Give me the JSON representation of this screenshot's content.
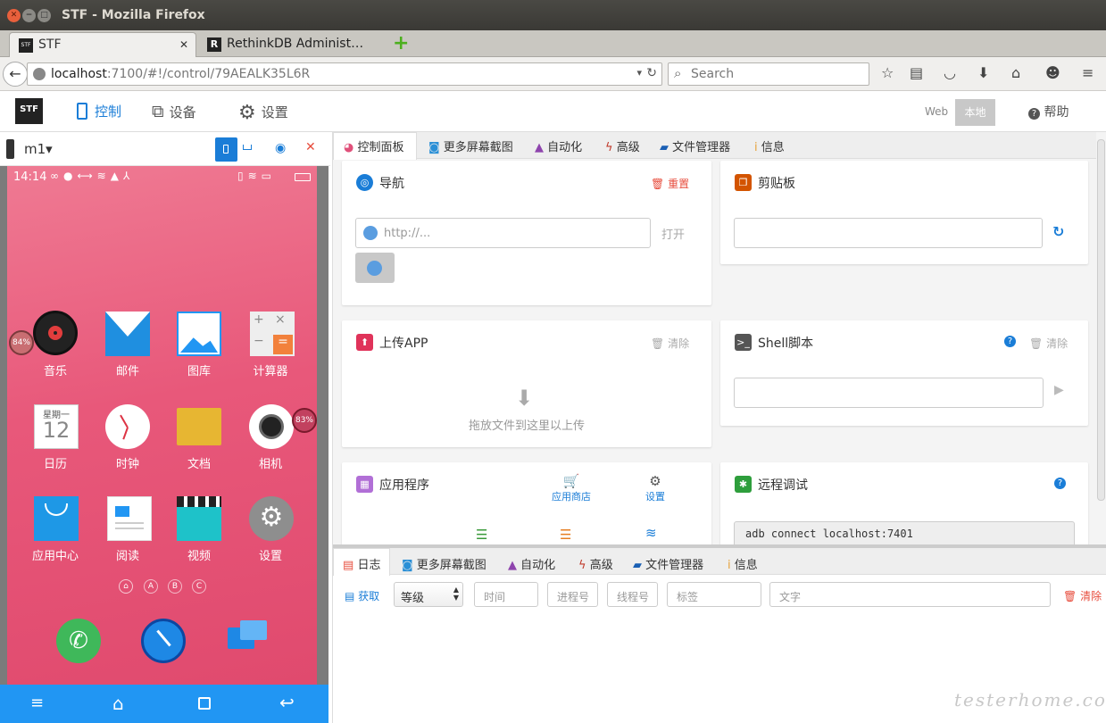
{
  "window": {
    "title": "STF - Mozilla Firefox"
  },
  "tabs": [
    {
      "title": "STF",
      "favicon": "STF"
    },
    {
      "title": "RethinkDB Administ…",
      "favicon": "R"
    }
  ],
  "urlbar": {
    "host": "localhost",
    "path": ":7100/#!/control/79AEALK35L6R"
  },
  "searchbar": {
    "placeholder": "Search"
  },
  "stf": {
    "logo": "STF",
    "nav": [
      {
        "label": "控制",
        "icon": "phone-icon"
      },
      {
        "label": "设备",
        "icon": "sitemap-icon"
      },
      {
        "label": "设置",
        "icon": "cogs-icon"
      }
    ],
    "mode_web": "Web",
    "mode_local": "本地",
    "help": "帮助"
  },
  "device": {
    "name": "m1",
    "statusbar": {
      "time": "14:14"
    },
    "apps": [
      {
        "label": "音乐",
        "icon": "music-icon"
      },
      {
        "label": "邮件",
        "icon": "mail-icon"
      },
      {
        "label": "图库",
        "icon": "gallery-icon"
      },
      {
        "label": "计算器",
        "icon": "calculator-icon"
      },
      {
        "label": "日历",
        "icon": "calendar-icon"
      },
      {
        "label": "时钟",
        "icon": "clock-icon"
      },
      {
        "label": "文档",
        "icon": "folder-icon"
      },
      {
        "label": "相机",
        "icon": "camera-icon"
      },
      {
        "label": "应用中心",
        "icon": "appstore-icon"
      },
      {
        "label": "阅读",
        "icon": "reader-icon"
      },
      {
        "label": "视频",
        "icon": "video-icon"
      },
      {
        "label": "设置",
        "icon": "settings-icon"
      }
    ],
    "calendar": {
      "weekday": "星期一",
      "day": "12"
    },
    "badges": {
      "left": "84%",
      "right": "83%"
    },
    "page_dots": [
      "A",
      "B",
      "C"
    ]
  },
  "control_tabs": [
    "控制面板",
    "更多屏幕截图",
    "自动化",
    "高级",
    "文件管理器",
    "信息"
  ],
  "panels": {
    "navigation": {
      "title": "导航",
      "reset": "重置",
      "url_placeholder": "http://...",
      "open": "打开"
    },
    "clipboard": {
      "title": "剪贴板"
    },
    "upload": {
      "title": "上传APP",
      "clear": "清除",
      "drop_hint": "拖放文件到这里以上传"
    },
    "shell": {
      "title": "Shell脚本",
      "clear": "清除"
    },
    "apps": {
      "title": "应用程序",
      "store": "应用商店",
      "settings": "设置"
    },
    "remote_debug": {
      "title": "远程调试",
      "command": "adb connect localhost:7401"
    }
  },
  "log_tabs": [
    "日志",
    "更多屏幕截图",
    "自动化",
    "高级",
    "文件管理器",
    "信息"
  ],
  "log_toolbar": {
    "fetch": "获取",
    "level": "等级",
    "time": "时间",
    "pid": "进程号",
    "tid": "线程号",
    "tag": "标签",
    "text": "文字",
    "clear": "清除"
  },
  "watermark": "testerhome.com"
}
